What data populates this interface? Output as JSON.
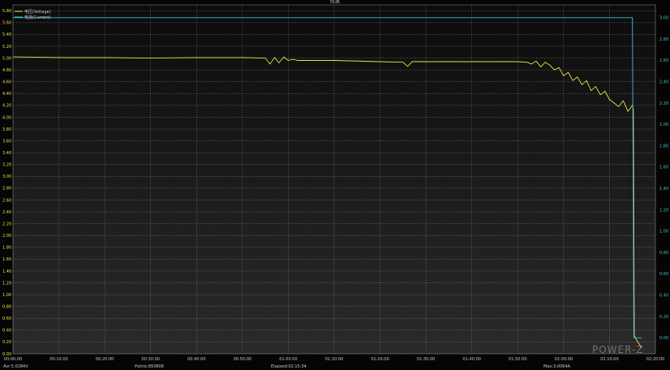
{
  "window": {
    "title": "纹波"
  },
  "legend": [
    {
      "label": "电压(Voltage)",
      "color": "#e6e04a"
    },
    {
      "label": "电流(Current)",
      "color": "#3fc3cf"
    }
  ],
  "status_bar": {
    "avg": "Avr:5.0284V",
    "points": "Points:893808",
    "elapsed": "Elapsed:02:15:34",
    "max": "Max:3.0064A"
  },
  "watermark": "POWER-Z",
  "chart_data": {
    "type": "line",
    "title": "纹波",
    "x_tick_labels": [
      "00:00:00",
      "00:10:00",
      "00:20:00",
      "00:30:00",
      "00:40:00",
      "00:50:00",
      "01:00:00",
      "01:10:00",
      "01:20:00",
      "01:30:00",
      "01:40:00",
      "01:50:00",
      "02:00:00",
      "02:10:00",
      "02:20:00"
    ],
    "xlim_minutes": [
      0,
      140
    ],
    "y_left": {
      "ylim": [
        0,
        5.9
      ],
      "ticks": [
        0.0,
        0.2,
        0.4,
        0.6,
        0.8,
        1.0,
        1.2,
        1.4,
        1.6,
        1.8,
        2.0,
        2.2,
        2.4,
        2.6,
        2.8,
        3.0,
        3.2,
        3.4,
        3.6,
        3.8,
        4.0,
        4.2,
        4.4,
        4.6,
        4.8,
        5.0,
        5.2,
        5.4,
        5.6,
        5.8
      ]
    },
    "y_right": {
      "ylim": [
        -0.15,
        3.12
      ],
      "ticks": [
        0.0,
        0.2,
        0.4,
        0.6,
        0.8,
        1.0,
        1.2,
        1.4,
        1.6,
        1.8,
        2.0,
        2.2,
        2.4,
        2.6,
        2.8,
        3.0
      ]
    },
    "grid": true,
    "series": [
      {
        "name": "电压(Voltage)",
        "axis": "left",
        "color": "#e6e04a",
        "x_minutes": [
          0,
          10,
          20,
          30,
          40,
          50,
          55,
          56,
          57,
          58,
          59,
          60,
          61,
          62,
          70,
          80,
          85,
          86,
          87,
          90,
          100,
          110,
          112,
          113,
          114,
          115,
          116,
          117,
          118,
          119,
          120,
          121,
          122,
          123,
          124,
          125,
          126,
          127,
          128,
          129,
          130,
          131,
          132,
          133,
          134,
          135,
          135.2,
          135.4,
          136,
          137
        ],
        "y": [
          5.02,
          5.01,
          5.01,
          5.0,
          5.01,
          5.01,
          5.0,
          4.9,
          5.01,
          4.92,
          5.02,
          4.96,
          4.98,
          4.96,
          4.96,
          4.94,
          4.93,
          4.86,
          4.94,
          4.94,
          4.94,
          4.94,
          4.93,
          4.9,
          4.95,
          4.85,
          4.93,
          4.88,
          4.8,
          4.84,
          4.7,
          4.76,
          4.62,
          4.68,
          4.55,
          4.62,
          4.45,
          4.52,
          4.38,
          4.44,
          4.3,
          4.24,
          4.18,
          4.28,
          4.1,
          4.2,
          4.14,
          0.3,
          0.22,
          0.1
        ]
      },
      {
        "name": "电流(Current)",
        "axis": "right",
        "color": "#3fc3cf",
        "x_minutes": [
          0,
          135,
          135.3,
          137
        ],
        "y": [
          3.0,
          3.0,
          0.0,
          0.0
        ]
      }
    ]
  }
}
